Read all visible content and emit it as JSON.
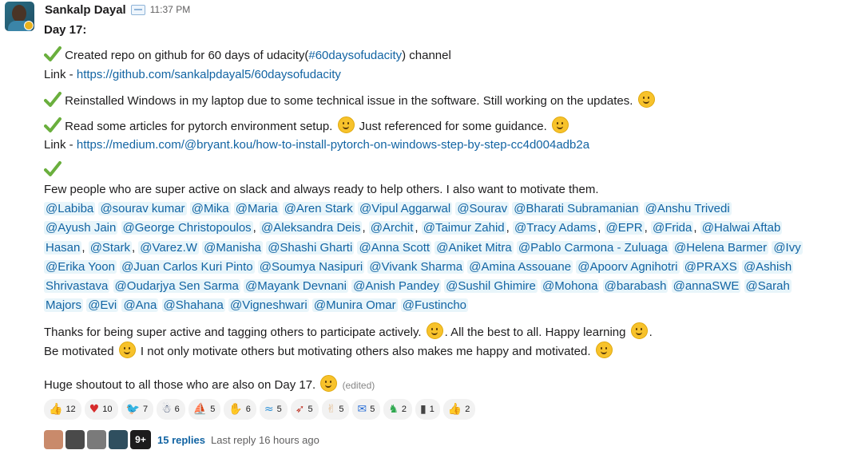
{
  "message": {
    "author": "Sankalp Dayal",
    "time": "11:37 PM",
    "day_label": "Day 17:",
    "item1_text_a": "Created repo on github for 60 days of udacity(",
    "item1_hashtag": "#60daysofudacity",
    "item1_text_b": ")  channel",
    "link_label": "Link - ",
    "link1": "https://github.com/sankalpdayal5/60daysofudacity",
    "item2_text": "Reinstalled Windows in my laptop due to some technical issue in the software. Still working on the updates.",
    "item3_text_a": "Read some articles for pytorch environment setup.",
    "item3_text_b": "Just referenced for some guidance.",
    "link2_label": "Link -  ",
    "link2": "https://medium.com/@bryant.kou/how-to-install-pytorch-on-windows-step-by-step-cc4d004adb2a",
    "item4_text": "Few people who are super active on slack and always ready to help others. I also want to motivate them.",
    "thanks_a": "Thanks for being super active and tagging others to participate actively. ",
    "thanks_b": ". All the best to all. Happy learning ",
    "thanks_c": ".",
    "motivated_a": "Be motivated ",
    "motivated_b": " I not only motivate others but motivating others also makes me happy and motivated.",
    "shoutout": "Huge shoutout to all those who are also on Day 17.",
    "edited": "(edited)"
  },
  "mention_lines": [
    [
      "@Labiba",
      "@sourav kumar",
      "@Mika",
      "@Maria",
      "@Aren Stark",
      "@Vipul Aggarwal",
      "@Sourav",
      "@Bharati Subramanian",
      "@Anshu Trivedi"
    ],
    [
      "@Ayush Jain",
      "@George Christopoulos",
      ",",
      "@Aleksandra Deis",
      ",",
      "@Archit",
      ",",
      "@Taimur Zahid",
      ",",
      "@Tracy Adams",
      ",",
      "@EPR",
      ",",
      "@Frida",
      ",",
      "@Halwai Aftab"
    ],
    [
      "Hasan",
      ",",
      "@Stark",
      ",",
      "@Varez.W",
      "@Manisha",
      "@Shashi Gharti",
      "@Anna Scott",
      "@Aniket Mitra",
      "@Pablo Carmona - Zuluaga",
      "@Helena Barmer",
      "@Ivy"
    ],
    [
      "@Erika Yoon",
      "@Juan Carlos Kuri Pinto",
      "@Soumya Nasipuri",
      "@Vivank Sharma",
      "@Amina Assouane",
      "@Apoorv Agnihotri",
      "@PRAXS",
      "@Ashish"
    ],
    [
      "Shrivastava",
      "@Oudarjya Sen Sarma",
      "@Mayank Devnani",
      "@Anish Pandey",
      "@Sushil Ghimire",
      "@Mohona",
      "@barabash",
      "@annaSWE",
      "@Sarah"
    ],
    [
      "Majors",
      "@Evi",
      "@Ana",
      "@Shahana",
      "@Vigneshwari",
      "@Munira Omar",
      "@Fustincho"
    ]
  ],
  "reactions": [
    {
      "icon": "thumbs-up-light-icon",
      "glyph": "👍",
      "color": "#e9c9a4",
      "count": "12"
    },
    {
      "icon": "heart-icon",
      "glyph": "♥",
      "color": "#d62b2b",
      "count": "10"
    },
    {
      "icon": "parrot-icon",
      "glyph": "🐦",
      "color": "#333333",
      "count": "7"
    },
    {
      "icon": "dancing-figure-icon",
      "glyph": "☃",
      "color": "#3a4a6b",
      "count": "6"
    },
    {
      "icon": "wave-hat-icon",
      "glyph": "⛵",
      "color": "#3a6b8a",
      "count": "5"
    },
    {
      "icon": "raised-hands-icon",
      "glyph": "✋",
      "color": "#d9a066",
      "count": "6"
    },
    {
      "icon": "water-wave-icon",
      "glyph": "≈",
      "color": "#2a8fd6",
      "count": "5"
    },
    {
      "icon": "rocket-icon",
      "glyph": "➶",
      "color": "#c0392b",
      "count": "5"
    },
    {
      "icon": "clapping-hands-icon",
      "glyph": "✌",
      "color": "#e2b98a",
      "count": "5"
    },
    {
      "icon": "thank-you-icon",
      "glyph": "✉",
      "color": "#2a6fd6",
      "count": "5"
    },
    {
      "icon": "green-figure-icon",
      "glyph": "♞",
      "color": "#2fa84f",
      "count": "2"
    },
    {
      "icon": "bottle-icon",
      "glyph": "▮",
      "color": "#444444",
      "count": "1"
    },
    {
      "icon": "thumbs-up-icon",
      "glyph": "👍",
      "color": "#f4b400",
      "count": "2"
    }
  ],
  "replies": {
    "avatar_colors": [
      "#c98a6b",
      "#4a4a4a",
      "#7a7a7a",
      "#2f4f5f"
    ],
    "more_label": "9+",
    "count": "15 replies",
    "last_reply": "Last reply 16 hours ago"
  },
  "colors": {
    "link": "#1264a3",
    "mention_bg": "#e8f5fa",
    "check": "#6aaf3d"
  }
}
